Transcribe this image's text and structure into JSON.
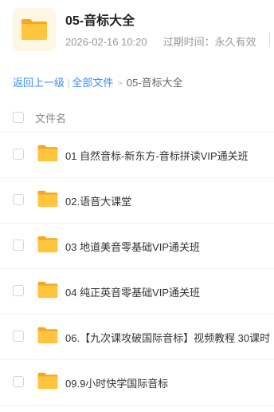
{
  "header": {
    "folder_name": "05-音标大全",
    "date": "2026-02-16 10:20",
    "expire_label": "过期时间：",
    "expire_value": "永久有效",
    "icon": "folder-icon",
    "icon_color": "#ffc53d"
  },
  "breadcrumb": {
    "back": "返回上一级",
    "separator": "|",
    "all_files": "全部文件",
    "arrow": ">",
    "current": "05-音标大全"
  },
  "list": {
    "column_title": "文件名",
    "items": [
      {
        "name": "01 自然音标-新东方-音标拼读VIP通关班",
        "icon": "folder-icon"
      },
      {
        "name": "02.语音大课堂",
        "icon": "folder-icon"
      },
      {
        "name": "03 地道美音零基础VIP通关班",
        "icon": "folder-icon"
      },
      {
        "name": "04 纯正英音零基础VIP通关班",
        "icon": "folder-icon"
      },
      {
        "name": "06.【九次课攻破国际音标】视频教程 30课时",
        "icon": "folder-icon"
      },
      {
        "name": "09.9小时快学国际音标",
        "icon": "folder-icon"
      }
    ]
  },
  "colors": {
    "accent": "#3b8cff",
    "folder": "#ffc53d"
  }
}
